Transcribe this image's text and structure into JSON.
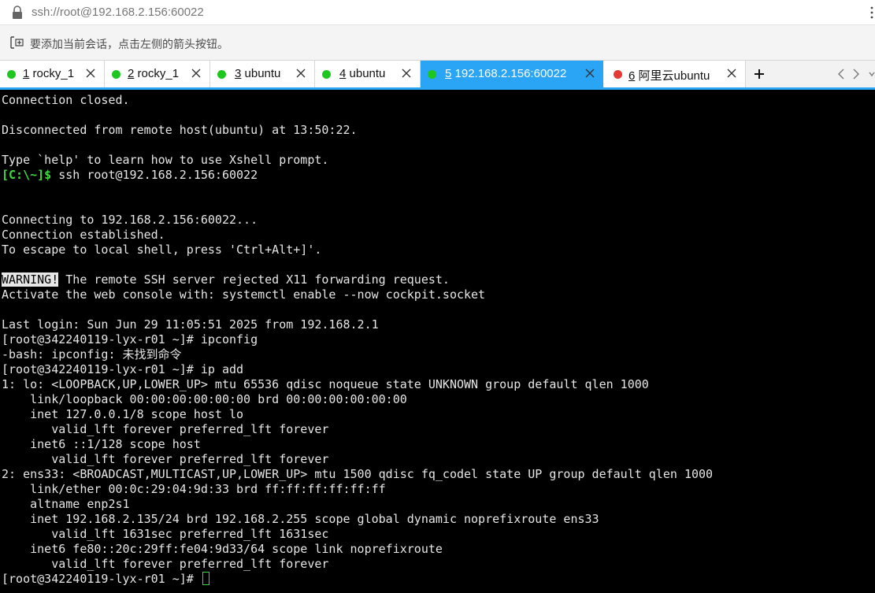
{
  "address": {
    "text": "ssh://root@192.168.2.156:60022"
  },
  "hint": {
    "text": "要添加当前会话，点击左侧的箭头按钮。"
  },
  "tabs": [
    {
      "num": "1",
      "name": " rocky_1",
      "status_color": "#1ec71e",
      "active": false
    },
    {
      "num": "2",
      "name": " rocky_1",
      "status_color": "#1ec71e",
      "active": false
    },
    {
      "num": "3",
      "name": " ubuntu",
      "status_color": "#1ec71e",
      "active": false
    },
    {
      "num": "4",
      "name": " ubuntu",
      "status_color": "#1ec71e",
      "active": false
    },
    {
      "num": "5",
      "name": " 192.168.2.156:60022",
      "status_color": "#1ec71e",
      "active": true
    },
    {
      "num": "6",
      "name": " 阿里云ubuntu",
      "status_color": "#e53935",
      "active": false
    }
  ],
  "colors": {
    "accent": "#2aa4f4",
    "terminal_bg": "#000000",
    "terminal_fg": "#e6e6e6",
    "prompt_green": "#3ed83e"
  },
  "terminal": {
    "l1": "Connection closed.",
    "l3": "Disconnected from remote host(ubuntu) at 13:50:22.",
    "l5": "Type `help' to learn how to use Xshell prompt.",
    "l6_prompt": "[C:\\~]$",
    "l6_cmd": " ssh root@192.168.2.156:60022",
    "l9": "Connecting to 192.168.2.156:60022...",
    "l10": "Connection established.",
    "l11": "To escape to local shell, press 'Ctrl+Alt+]'.",
    "l13_warn": "WARNING!",
    "l13_rest": " The remote SSH server rejected X11 forwarding request.",
    "l14": "Activate the web console with: systemctl enable --now cockpit.socket",
    "l16": "Last login: Sun Jun 29 11:05:51 2025 from 192.168.2.1",
    "l17": "[root@342240119-lyx-r01 ~]# ipconfig",
    "l18": "-bash: ipconfig: 未找到命令",
    "l19": "[root@342240119-lyx-r01 ~]# ip add",
    "l20": "1: lo: <LOOPBACK,UP,LOWER_UP> mtu 65536 qdisc noqueue state UNKNOWN group default qlen 1000",
    "l21": "    link/loopback 00:00:00:00:00:00 brd 00:00:00:00:00:00",
    "l22": "    inet 127.0.0.1/8 scope host lo",
    "l23": "       valid_lft forever preferred_lft forever",
    "l24": "    inet6 ::1/128 scope host",
    "l25": "       valid_lft forever preferred_lft forever",
    "l26": "2: ens33: <BROADCAST,MULTICAST,UP,LOWER_UP> mtu 1500 qdisc fq_codel state UP group default qlen 1000",
    "l27": "    link/ether 00:0c:29:04:9d:33 brd ff:ff:ff:ff:ff:ff",
    "l28": "    altname enp2s1",
    "l29": "    inet 192.168.2.135/24 brd 192.168.2.255 scope global dynamic noprefixroute ens33",
    "l30": "       valid_lft 1631sec preferred_lft 1631sec",
    "l31": "    inet6 fe80::20c:29ff:fe04:9d33/64 scope link noprefixroute",
    "l32": "       valid_lft forever preferred_lft forever",
    "l33": "[root@342240119-lyx-r01 ~]# "
  }
}
